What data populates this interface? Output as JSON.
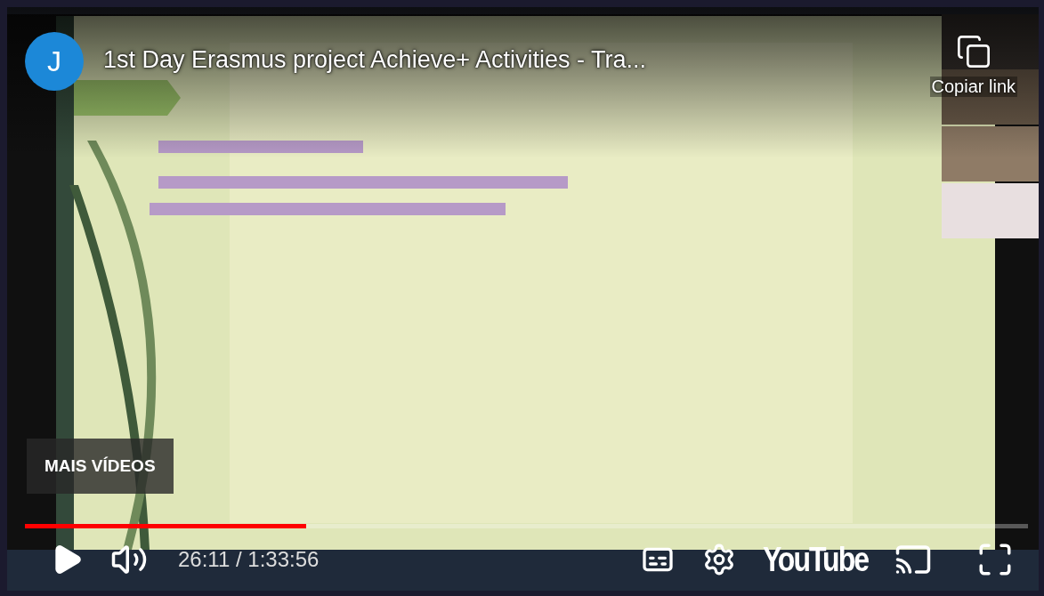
{
  "header": {
    "avatar": "J",
    "title": "1st Day Erasmus project Achieve+ Activities - Tra...",
    "copy_link": "Copiar link"
  },
  "more_videos": "MAIS VÍDEOS",
  "progress": {
    "level": 0.28
  },
  "controls": {
    "time": "26:11 / 1:33:56",
    "logo": "YouTube"
  }
}
